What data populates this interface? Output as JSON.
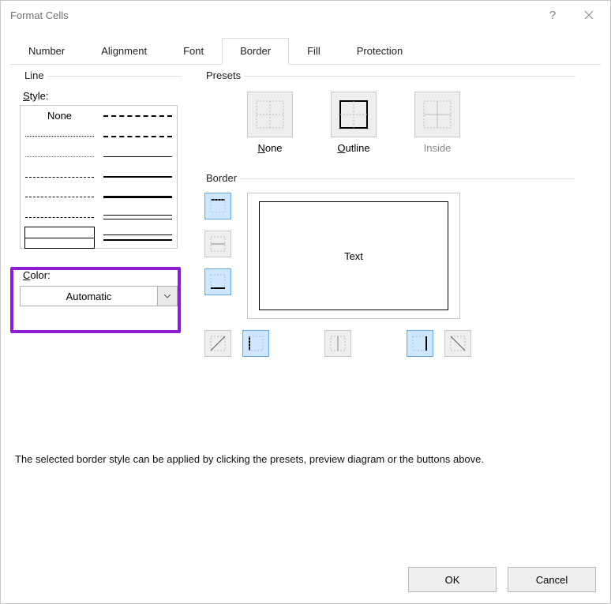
{
  "window": {
    "title": "Format Cells"
  },
  "tabs": [
    "Number",
    "Alignment",
    "Font",
    "Border",
    "Fill",
    "Protection"
  ],
  "active_tab": 3,
  "line": {
    "group_label": "Line",
    "style_label": "Style:",
    "none_label": "None",
    "color_label": "Color:",
    "color_value": "Automatic"
  },
  "presets": {
    "group_label": "Presets",
    "items": [
      {
        "key": "N",
        "rest": "one"
      },
      {
        "key": "O",
        "rest": "utline"
      },
      {
        "key": "I",
        "rest": "nside"
      }
    ]
  },
  "border": {
    "group_label": "Border",
    "preview_text": "Text"
  },
  "help_text": "The selected border style can be applied by clicking the presets, preview diagram or the buttons above.",
  "buttons": {
    "ok": "OK",
    "cancel": "Cancel"
  }
}
